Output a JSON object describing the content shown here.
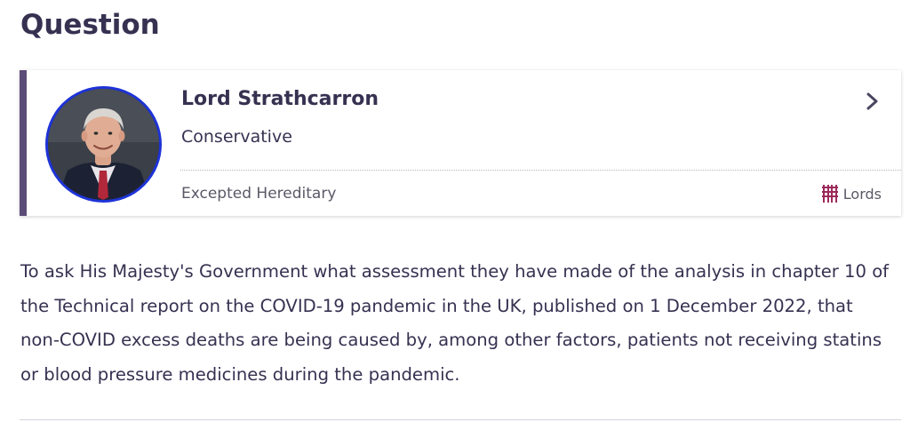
{
  "page": {
    "heading": "Question"
  },
  "member": {
    "name": "Lord Strathcarron",
    "party": "Conservative",
    "constituency": "Excepted Hereditary",
    "house": "Lords",
    "house_icon": "portcullis-icon",
    "avatar_border_color": "#1e33d8",
    "accent_color": "#5c4c78",
    "house_color": "#9c2a5c"
  },
  "question": {
    "text": "To ask His Majesty's Government what assessment they have made of the analysis in chapter 10 of the Technical report on the COVID-19 pandemic in the UK, published on 1 December 2022, that non-COVID excess deaths are being caused by, among other factors, patients not receiving statins or blood pressure medicines during the pandemic."
  }
}
